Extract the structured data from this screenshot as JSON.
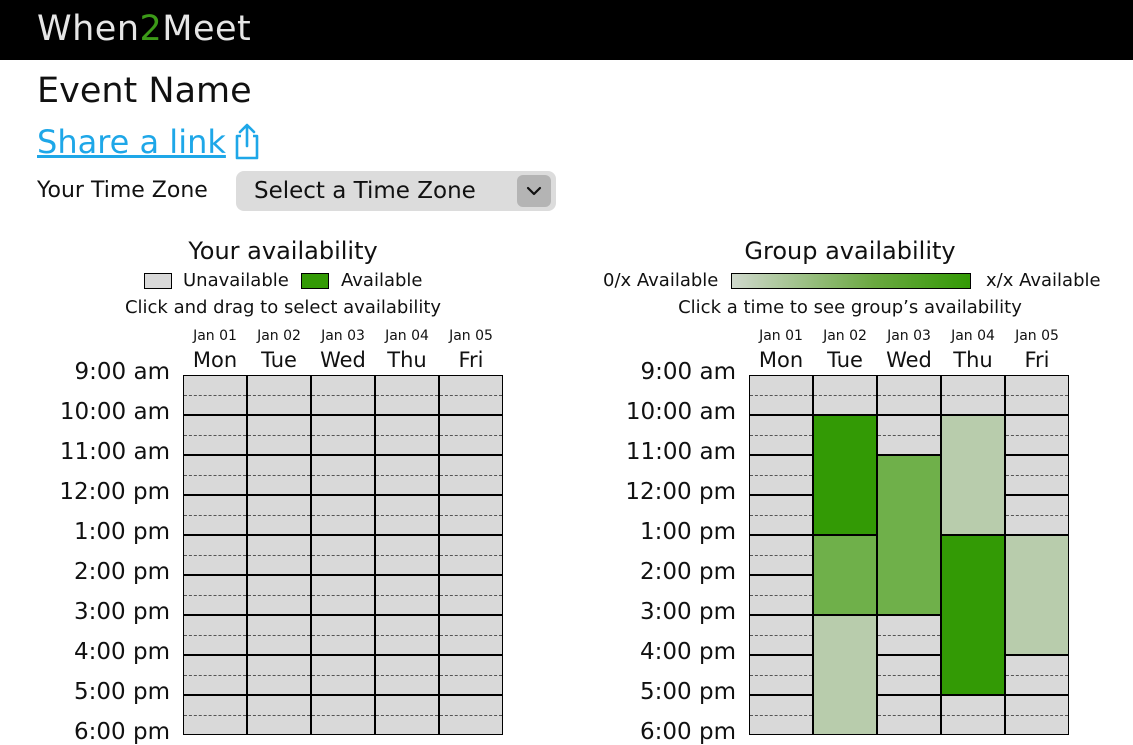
{
  "app": {
    "logo_part1": "When",
    "logo_part2": "2",
    "logo_part3": "Meet"
  },
  "event": {
    "name": "Event Name",
    "share_label": "Share a link"
  },
  "timezone": {
    "label": "Your Time Zone",
    "selected": "Select a Time Zone"
  },
  "columns": [
    {
      "date": "Jan 01",
      "day": "Mon"
    },
    {
      "date": "Jan 02",
      "day": "Tue"
    },
    {
      "date": "Jan 03",
      "day": "Wed"
    },
    {
      "date": "Jan 04",
      "day": "Thu"
    },
    {
      "date": "Jan 05",
      "day": "Fri"
    }
  ],
  "times": [
    "9:00 am",
    "10:00 am",
    "11:00 am",
    "12:00 pm",
    "1:00 pm",
    "2:00 pm",
    "3:00 pm",
    "4:00 pm",
    "5:00 pm",
    "6:00 pm"
  ],
  "your_availability": {
    "title": "Your availability",
    "legend_unavailable": "Unavailable",
    "legend_available": "Available",
    "instruction": "Click and drag to select availability"
  },
  "group_availability": {
    "title": "Group availability",
    "legend_min": "0/x Available",
    "legend_max": "x/x Available",
    "instruction": "Click a time to see group’s availability",
    "blocks": [
      {
        "day": "Tue",
        "start": "10:00 am",
        "end": "1:00 pm",
        "level": "high"
      },
      {
        "day": "Tue",
        "start": "1:00 pm",
        "end": "3:00 pm",
        "level": "medium"
      },
      {
        "day": "Tue",
        "start": "3:00 pm",
        "end": "6:00 pm",
        "level": "low"
      },
      {
        "day": "Wed",
        "start": "11:00 am",
        "end": "3:00 pm",
        "level": "medium"
      },
      {
        "day": "Thu",
        "start": "10:00 am",
        "end": "1:00 pm",
        "level": "low"
      },
      {
        "day": "Thu",
        "start": "1:00 pm",
        "end": "5:00 pm",
        "level": "high"
      },
      {
        "day": "Fri",
        "start": "1:00 pm",
        "end": "4:00 pm",
        "level": "low"
      }
    ]
  },
  "colors": {
    "unavailable": "#d9d9d9",
    "available": "#339a05",
    "level_high": "#339a05",
    "level_medium": "#6fb04a",
    "level_low": "#b8ccac",
    "brand_accent": "#3c9a18",
    "link": "#1ea7e8"
  },
  "icons": {
    "share": "share-icon",
    "dropdown": "chevron-down-icon"
  }
}
